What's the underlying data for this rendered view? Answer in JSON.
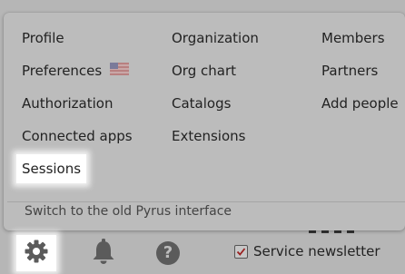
{
  "menu": {
    "col1": [
      {
        "label": "Profile"
      },
      {
        "label": "Preferences"
      },
      {
        "label": "Authorization"
      },
      {
        "label": "Connected apps"
      },
      {
        "label": "Sessions"
      }
    ],
    "col2": [
      {
        "label": "Organization"
      },
      {
        "label": "Org chart"
      },
      {
        "label": "Catalogs"
      },
      {
        "label": "Extensions"
      }
    ],
    "col3": [
      {
        "label": "Members"
      },
      {
        "label": "Partners"
      },
      {
        "label": "Add people"
      }
    ],
    "preferences_flag_icon": "us-flag-icon",
    "old_interface_link": "Switch to the old Pyrus interface"
  },
  "toolbar": {
    "settings_icon": "gear-icon",
    "notifications_icon": "bell-icon",
    "help_icon": "help-icon",
    "help_glyph": "?"
  },
  "newsletter": {
    "label": "Service newsletter",
    "checked": true
  },
  "colors": {
    "overlay_bg": "#b6b6b6",
    "menu_bg": "#bcbcbc",
    "highlight": "#ffffff",
    "text": "#222222",
    "icon": "#5b5b5b"
  }
}
